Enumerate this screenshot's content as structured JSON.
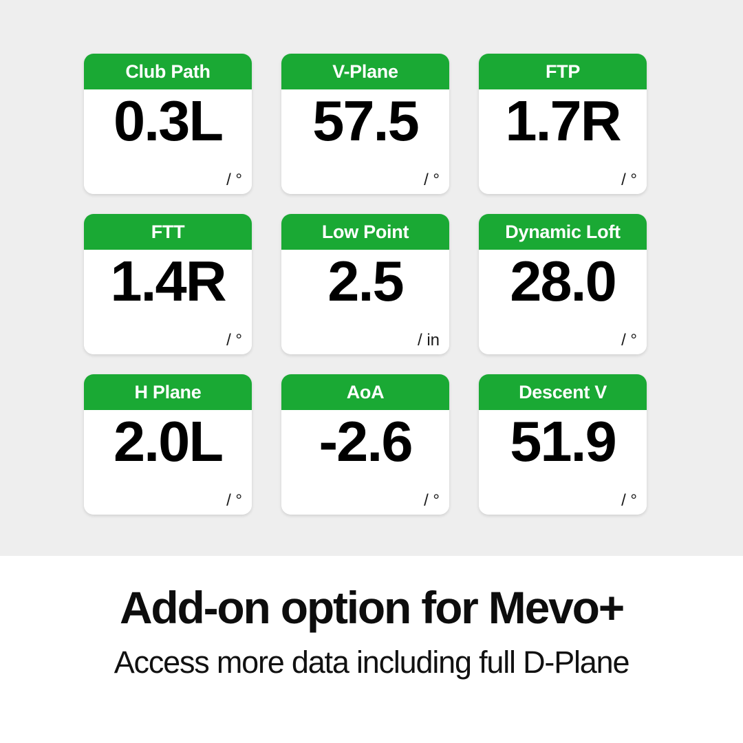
{
  "background": {
    "panel_color": "#eeeeee",
    "caption_band_color": "#ffffff"
  },
  "theme": {
    "accent_green": "#1aa934",
    "header_text_color": "#ffffff",
    "value_text_color": "#000000"
  },
  "metrics": [
    {
      "label": "Club Path",
      "value": "0.3L",
      "unit": "/ °"
    },
    {
      "label": "V-Plane",
      "value": "57.5",
      "unit": "/ °"
    },
    {
      "label": "FTP",
      "value": "1.7R",
      "unit": "/ °"
    },
    {
      "label": "FTT",
      "value": "1.4R",
      "unit": "/ °"
    },
    {
      "label": "Low Point",
      "value": "2.5",
      "unit": "/ in"
    },
    {
      "label": "Dynamic Loft",
      "value": "28.0",
      "unit": "/ °"
    },
    {
      "label": "H Plane",
      "value": "2.0L",
      "unit": "/ °"
    },
    {
      "label": "AoA",
      "value": "-2.6",
      "unit": "/ °"
    },
    {
      "label": "Descent V",
      "value": "51.9",
      "unit": "/ °"
    }
  ],
  "caption": {
    "title": "Add-on option for Mevo+",
    "subtitle": "Access more data including full D-Plane"
  }
}
